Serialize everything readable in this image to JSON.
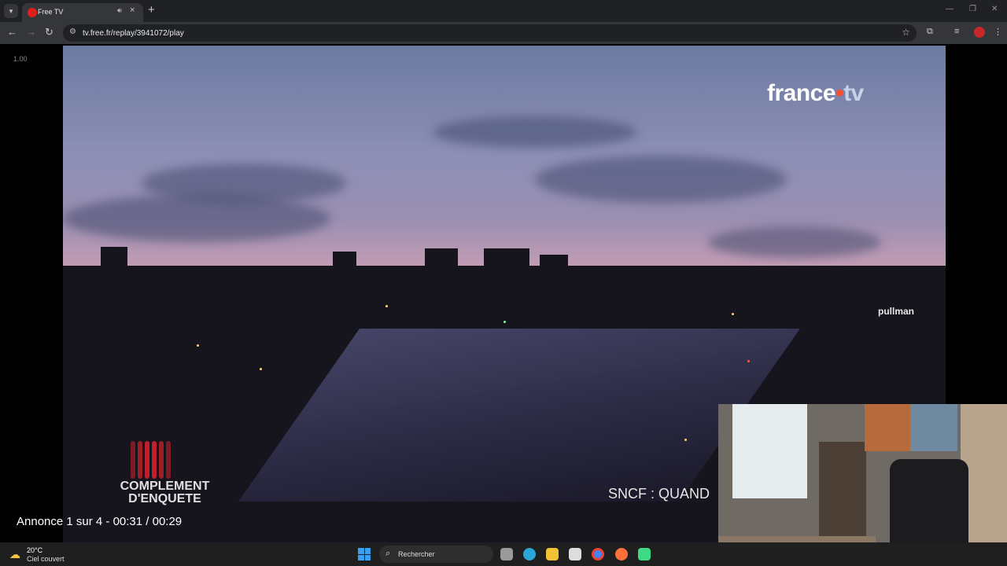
{
  "browser": {
    "tab": {
      "title": "Free TV"
    },
    "url": "tv.free.fr/replay/3941072/play"
  },
  "player": {
    "speed_label": "1.00",
    "channel_logo": {
      "word": "france",
      "suffix": "tv"
    },
    "pullman_text": "pullman",
    "show_logo_text": "COMPLEMENT\nD'ENQUETE",
    "subtitle": "SNCF : QUAND",
    "ad_counter": "Annonce 1 sur 4 - 00:31 / 00:29"
  },
  "taskbar": {
    "weather": {
      "temperature": "20°C",
      "description": "Ciel couvert"
    },
    "search_label": "Rechercher",
    "apps": [
      "task-view",
      "edge",
      "file-explorer",
      "store",
      "chrome",
      "firefox",
      "app-green"
    ]
  },
  "colors": {
    "brand_red": "#e02020",
    "ce_red": "#c0202c",
    "taskbar": "#1f1f1f"
  }
}
